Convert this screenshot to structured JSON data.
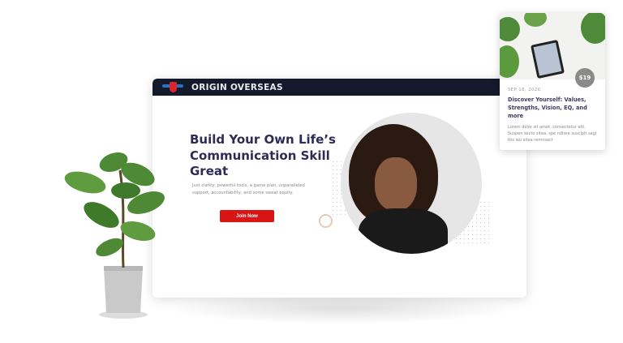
{
  "header": {
    "brand": "ORIGIN OVERSEAS"
  },
  "hero": {
    "title": "Build Your Own Life’s Communication Skill Great",
    "subtitle": "Just clarity, powerful tools, a game plan, unparalleled support, accountability, and some sweat equity.",
    "cta": "Join Now"
  },
  "card": {
    "price": "$19",
    "date": "SEP 16, 2020",
    "title": "Discover Yourself: Values, Strengths, Vision, EQ, and more",
    "description": "Lorem dolor sit amet, consectetur elit. Suspen secto sitea. spe ndisse suscipit sagi ttis leo sitea remnsect"
  },
  "colors": {
    "header": "#131a2b",
    "accent": "#d81414",
    "heading": "#2e2b54"
  }
}
